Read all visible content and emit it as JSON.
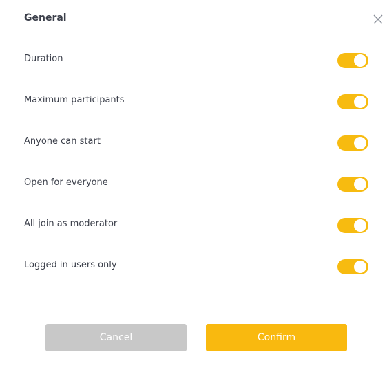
{
  "dialog": {
    "title": "General",
    "close_icon": "close-icon"
  },
  "settings": [
    {
      "label": "Duration",
      "enabled": true
    },
    {
      "label": "Maximum participants",
      "enabled": true
    },
    {
      "label": "Anyone can start",
      "enabled": true
    },
    {
      "label": "Open for everyone",
      "enabled": true
    },
    {
      "label": "All join as moderator",
      "enabled": true
    },
    {
      "label": "Logged in users only",
      "enabled": true
    }
  ],
  "buttons": {
    "cancel_label": "Cancel",
    "confirm_label": "Confirm"
  },
  "colors": {
    "toggle_on": "#f7bb10",
    "confirm": "#f9b90f",
    "cancel": "#c8c8c8"
  }
}
